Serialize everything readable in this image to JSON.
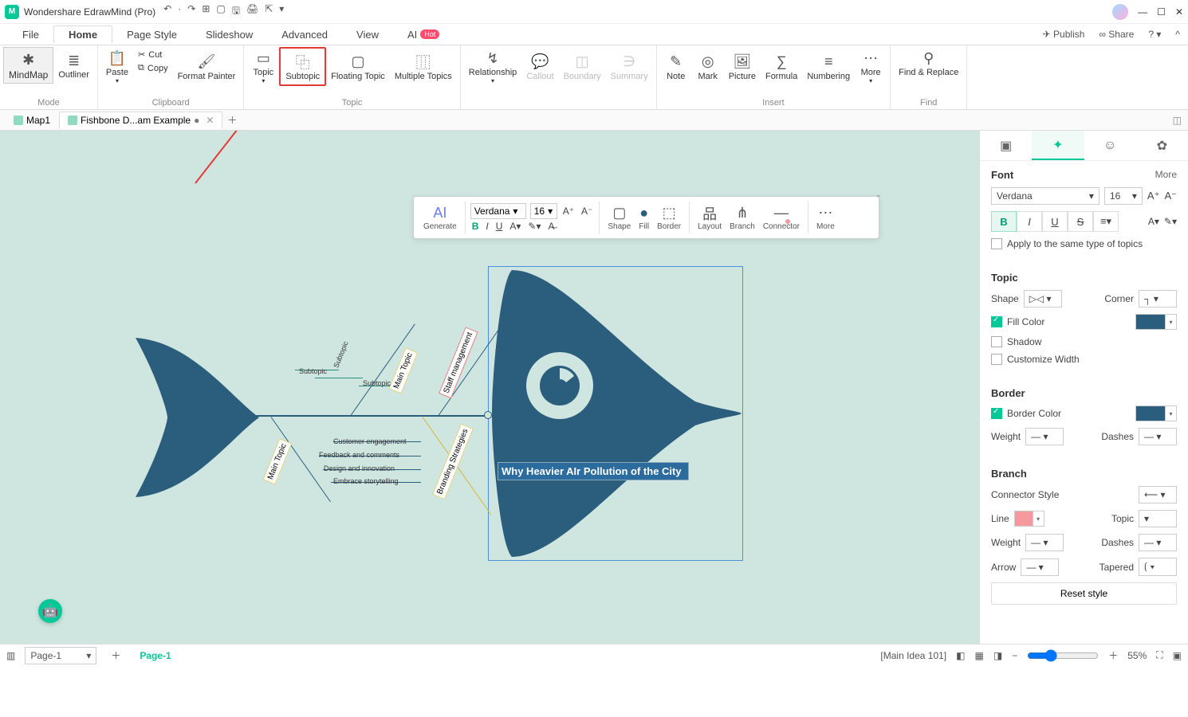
{
  "title": "Wondershare EdrawMind (Pro)",
  "menubar": [
    "File",
    "Home",
    "Page Style",
    "Slideshow",
    "Advanced",
    "View",
    "AI"
  ],
  "menubar_active": "Home",
  "ai_badge": "Hot",
  "topright": {
    "publish": "Publish",
    "share": "Share"
  },
  "qat_icons": [
    "undo",
    "redo",
    "new",
    "open",
    "save",
    "print",
    "export"
  ],
  "ribbon": {
    "mode": {
      "mindmap": "MindMap",
      "outliner": "Outliner",
      "label": "Mode"
    },
    "clipboard": {
      "paste": "Paste",
      "cut": "Cut",
      "copy": "Copy",
      "painter": "Format Painter",
      "label": "Clipboard"
    },
    "topic": {
      "topic": "Topic",
      "subtopic": "Subtopic",
      "floating": "Floating Topic",
      "multiple": "Multiple Topics",
      "label": "Topic"
    },
    "insert": {
      "relationship": "Relationship",
      "callout": "Callout",
      "boundary": "Boundary",
      "summary": "Summary",
      "note": "Note",
      "mark": "Mark",
      "picture": "Picture",
      "formula": "Formula",
      "numbering": "Numbering",
      "more": "More",
      "label": "Insert"
    },
    "find": {
      "find": "Find & Replace",
      "label": "Find"
    }
  },
  "tabs": [
    {
      "name": "Map1"
    },
    {
      "name": "Fishbone D...am Example",
      "dirty": true
    }
  ],
  "float_toolbar": {
    "generate": "Generate",
    "font": "Verdana",
    "size": "16",
    "shape": "Shape",
    "fill": "Fill",
    "border": "Border",
    "layout": "Layout",
    "branch": "Branch",
    "connector": "Connector",
    "more": "More"
  },
  "diagram": {
    "main": "Why Heavier AIr Pollution of the City",
    "upper_branches": [
      {
        "title": "Main Topic",
        "subs": [
          "Subtopic",
          "Subtopic",
          "Subtopic"
        ]
      },
      {
        "title": "Staff management",
        "subs": []
      }
    ],
    "lower_branches": [
      {
        "title": "Main Topic",
        "subs": []
      },
      {
        "title": "Branding Strategies",
        "subs": [
          "Customer engagement",
          "Feedback and comments",
          "Design and innovation",
          "Embrace storytelling"
        ]
      }
    ]
  },
  "rightpanel": {
    "font_hdr": "Font",
    "more": "More",
    "font_name": "Verdana",
    "font_size": "16",
    "apply": "Apply to the same type of topics",
    "topic_hdr": "Topic",
    "shape": "Shape",
    "corner": "Corner",
    "fillcolor": "Fill Color",
    "shadow": "Shadow",
    "customwidth": "Customize Width",
    "border_hdr": "Border",
    "bordercolor": "Border Color",
    "weight": "Weight",
    "dashes": "Dashes",
    "branch_hdr": "Branch",
    "connstyle": "Connector Style",
    "line": "Line",
    "topic": "Topic",
    "arrow": "Arrow",
    "tapered": "Tapered",
    "reset": "Reset style",
    "fill_hex": "#2b5d7d",
    "border_hex": "#2b5d7d",
    "line_hex": "#f6999e"
  },
  "status": {
    "page_sel": "Page-1",
    "page_active": "Page-1",
    "info": "[Main Idea 101]",
    "zoom": "55%"
  }
}
